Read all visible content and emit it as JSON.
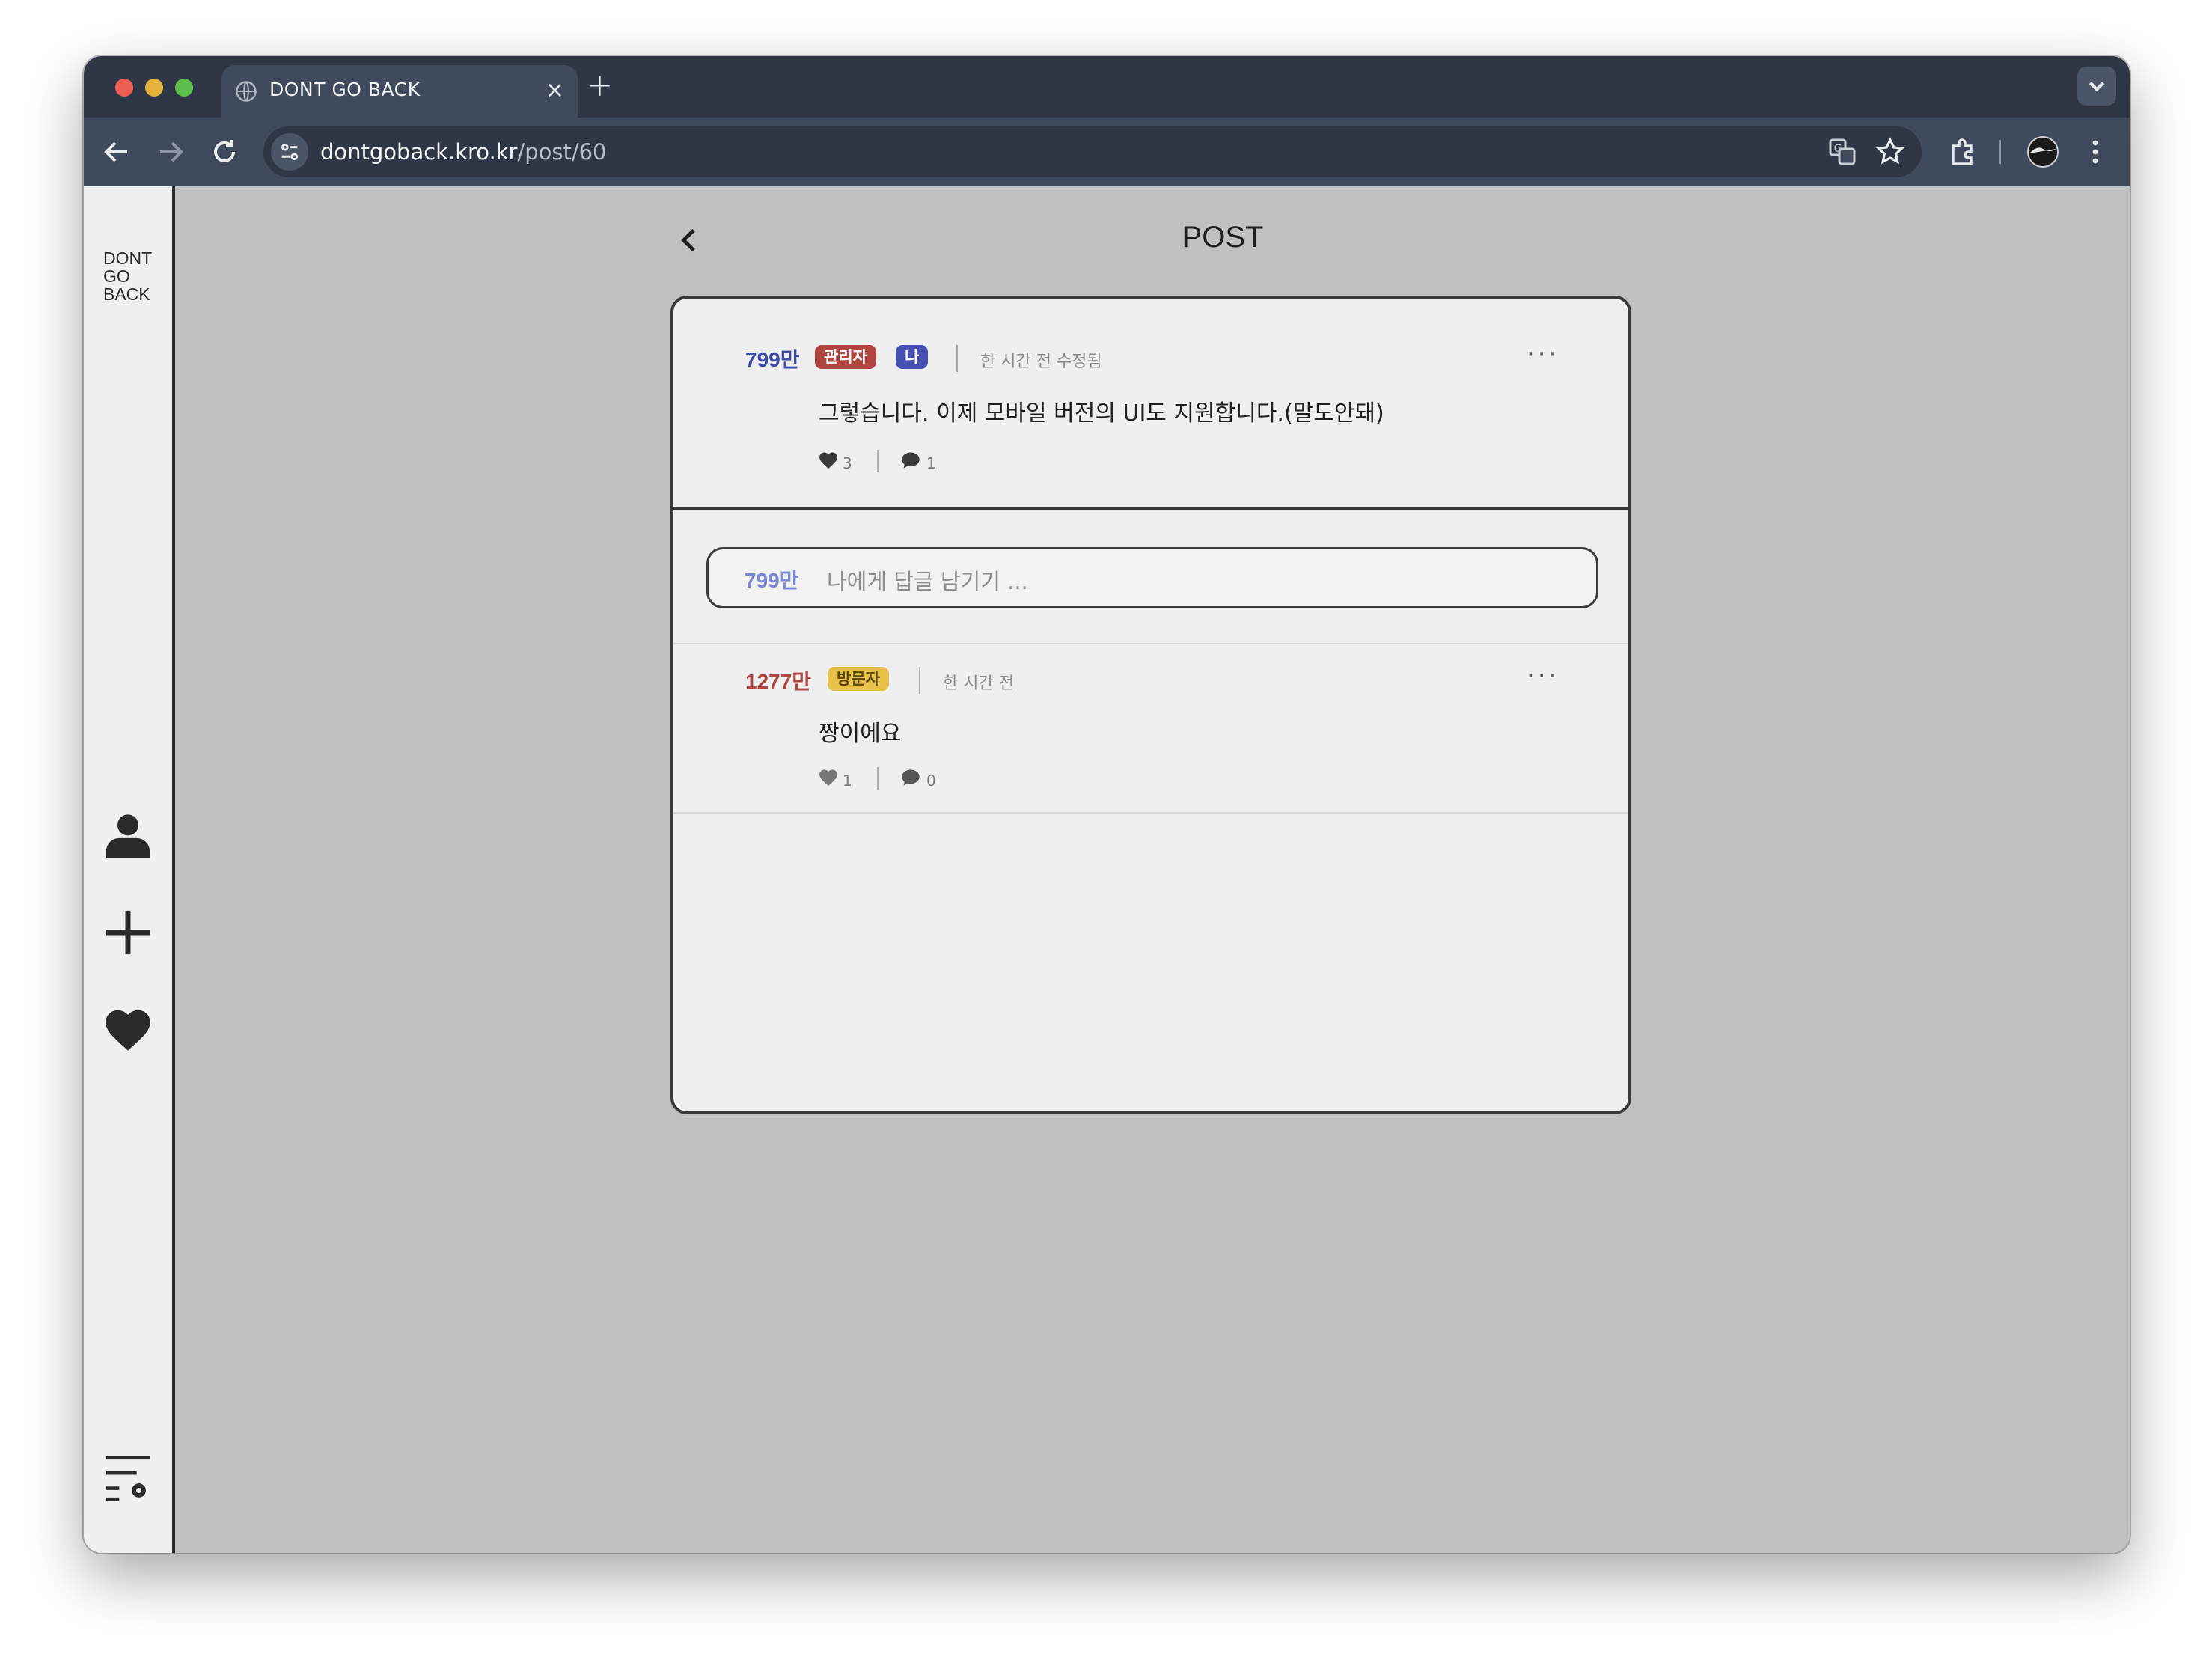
{
  "browser": {
    "tab_title": "DONT GO BACK",
    "tab_close": "×",
    "new_tab": "+",
    "url_host": "dontgoback.kro.kr",
    "url_path": "/post/60"
  },
  "sidebar": {
    "logo": "DONT\nGO\nBACK",
    "icons": [
      "user-icon",
      "plus-icon",
      "heart-icon",
      "settings-list-icon"
    ]
  },
  "page": {
    "title": "POST"
  },
  "post": {
    "author": "799만",
    "author_color": "#3b4aa8",
    "badges": [
      {
        "label": "관리자",
        "color": "#b0443f"
      },
      {
        "label": "나",
        "color": "#4650b0"
      }
    ],
    "meta": "한 시간 전 수정됨",
    "more": "···",
    "content": "그렇습니다. 이제 모바일 버전의 UI도 지원합니다.(말도안돼)",
    "likes": "3",
    "comments": "1"
  },
  "reply_input": {
    "name": "799만",
    "placeholder": "나에게 답글 남기기 ..."
  },
  "comments": [
    {
      "author": "1277만",
      "author_color": "#b0443f",
      "badge": {
        "label": "방문자",
        "color": "#e7c14a"
      },
      "meta": "한 시간 전",
      "more": "···",
      "content": "짱이에요",
      "likes": "1",
      "comments": "0"
    }
  ]
}
